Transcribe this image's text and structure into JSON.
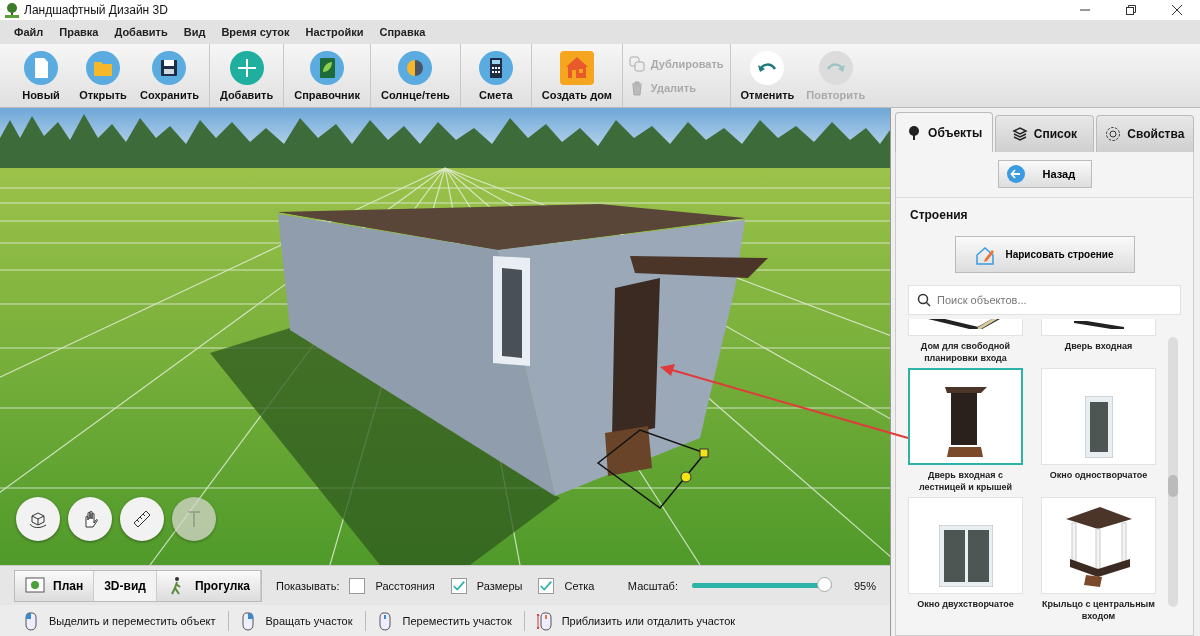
{
  "window": {
    "title": "Ландшафтный Дизайн 3D"
  },
  "menu": [
    "Файл",
    "Правка",
    "Добавить",
    "Вид",
    "Время суток",
    "Настройки",
    "Справка"
  ],
  "toolbar": {
    "groups": [
      [
        {
          "label": "Новый",
          "kind": "new",
          "disabled": false
        },
        {
          "label": "Открыть",
          "kind": "open",
          "disabled": false
        },
        {
          "label": "Сохранить",
          "kind": "save",
          "disabled": false
        }
      ],
      [
        {
          "label": "Добавить",
          "kind": "add",
          "disabled": false
        }
      ],
      [
        {
          "label": "Справочник",
          "kind": "guide",
          "disabled": false
        }
      ],
      [
        {
          "label": "Солнце/тень",
          "kind": "sun",
          "disabled": false
        }
      ],
      [
        {
          "label": "Смета",
          "kind": "estimate",
          "disabled": false
        }
      ],
      [
        {
          "label": "Создать дом",
          "kind": "house",
          "disabled": false
        }
      ],
      [
        {
          "label": "Дублировать",
          "kind": "duplicate",
          "disabled": true
        },
        {
          "label": "Удалить",
          "kind": "delete",
          "disabled": true
        }
      ],
      [
        {
          "label": "Отменить",
          "kind": "undo",
          "disabled": false
        },
        {
          "label": "Повторить",
          "kind": "redo",
          "disabled": true
        }
      ]
    ]
  },
  "view_tools": [
    {
      "kind": "rotate",
      "disabled": false
    },
    {
      "kind": "pan",
      "disabled": false
    },
    {
      "kind": "ruler",
      "disabled": false
    },
    {
      "kind": "text",
      "disabled": true
    }
  ],
  "panel": {
    "tabs": [
      {
        "label": "Объекты",
        "kind": "tree",
        "selected": true
      },
      {
        "label": "Список",
        "kind": "layers",
        "selected": false
      },
      {
        "label": "Свойства",
        "kind": "gear",
        "selected": false
      }
    ],
    "back_button": "Назад",
    "section_title": "Строения",
    "draw_button": "Нарисовать строение",
    "search": {
      "placeholder": "Поиск объектов..."
    },
    "objects": [
      {
        "label": "Дом для свободной планировки входа",
        "kind": "house",
        "selected": false
      },
      {
        "label": "Дверь входная",
        "kind": "door",
        "selected": false
      },
      {
        "label": "Дверь входная с лестницей и крышей",
        "kind": "door-stairs",
        "selected": true
      },
      {
        "label": "Окно одностворчатое",
        "kind": "window-single",
        "selected": false
      },
      {
        "label": "Окно двухстворчатое",
        "kind": "window-double",
        "selected": false
      },
      {
        "label": "Крыльцо с центральным входом",
        "kind": "porch",
        "selected": false
      }
    ]
  },
  "bottom_bar": {
    "view_modes": [
      {
        "label": "План",
        "kind": "plan",
        "selected": false
      },
      {
        "label": "3D-вид",
        "kind": "perspective",
        "selected": true
      },
      {
        "label": "Прогулка",
        "kind": "walk",
        "selected": false
      }
    ],
    "show_label": "Показывать:",
    "options": [
      {
        "label": "Расстояния",
        "checked": false
      },
      {
        "label": "Размеры",
        "checked": true
      },
      {
        "label": "Сетка",
        "checked": true
      }
    ],
    "scale": {
      "label": "Масштаб:",
      "level": 0.95,
      "reading": "95%"
    }
  },
  "status_bar": [
    {
      "label": "Выделить и переместить объект",
      "kind": "left-click"
    },
    {
      "label": "Вращать участок",
      "kind": "right-click"
    },
    {
      "label": "Переместить участок",
      "kind": "middle-click"
    },
    {
      "label": "Приблизить или отдалить участок",
      "kind": "wheel"
    }
  ]
}
